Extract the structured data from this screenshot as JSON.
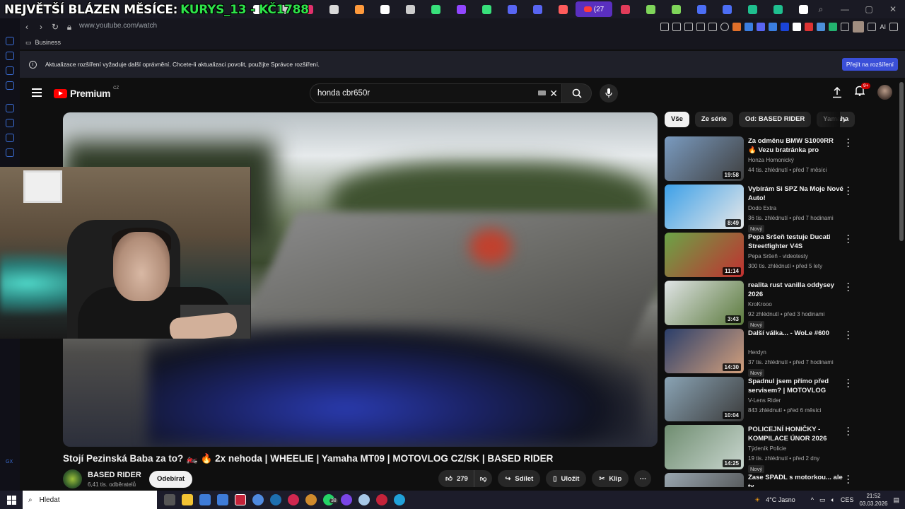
{
  "overlay": {
    "part1": "NEJVĚTŠÍ BLÁZEN MĚSÍCE:",
    "part2": "KURYS_13 - KČ1788"
  },
  "browser": {
    "active_tab_count": "(27",
    "url": "www.youtube.com/watch",
    "bookmark": "Business",
    "ai_label": "AI",
    "tab_colors": [
      "#ffffff",
      "#cfcfcf",
      "#e1306c",
      "#d9d9d9",
      "#ff9a3c",
      "#ffffff",
      "#cccccc",
      "#38e07b",
      "#9146ff",
      "#38e07b",
      "#5865f2",
      "#5865f2",
      "#ff5c5c",
      "#ff9a3c",
      "#e23c5a",
      "#7fd55a",
      "#7fd55a",
      "#4c6ef5",
      "#4c6ef5",
      "#1fbf8f",
      "#1fbf8f",
      "#ffffff"
    ]
  },
  "notification": {
    "text": "Aktualizace rozšíření vyžaduje další oprávnění. Chcete-li aktualizaci povolit, použijte Správce rozšíření.",
    "button": "Přejít na rozšíření"
  },
  "youtube": {
    "logo_text": "Premium",
    "logo_region": "CZ",
    "search_value": "honda cbr650r",
    "notif_count": "9+",
    "video_title": "Stojí Pezinská Baba za to? 🏍️ 🔥 2x nehoda | WHEELIE | Yamaha MT09 | MOTOVLOG CZ/SK | BASED RIDER",
    "channel": {
      "name": "BASED RIDER",
      "subs": "6,41 tis. odběratelů",
      "subscribe": "Odebírat"
    },
    "actions": {
      "likes": "279",
      "share": "Sdílet",
      "save": "Uložit",
      "clip": "Klip"
    },
    "chips": [
      "Vše",
      "Ze série",
      "Od: BASED RIDER",
      "Yamaha"
    ],
    "recommendations": [
      {
        "title": "Za odměnu BMW S1000RR 🔥 Vezu bratránka pro vysvědčení",
        "channel": "Honza Homonický",
        "meta": "44 tis. zhlédnutí • před 7 měsíci",
        "duration": "19:58",
        "badge": "",
        "colors": [
          "#7a9bc0",
          "#3f3f3f"
        ]
      },
      {
        "title": "Vybírám Si SPZ Na Moje Nové Auto!",
        "channel": "Dodo Extra",
        "meta": "36 tis. zhlédnutí • před 7 hodinami",
        "duration": "8:49",
        "badge": "Nový",
        "colors": [
          "#3ca0e8",
          "#e8e8e8"
        ]
      },
      {
        "title": "Pepa Sršeň testuje Ducati Streetfighter V4S",
        "channel": "Pepa Sršeň - videotesty",
        "meta": "300 tis. zhlédnutí • před 5 lety",
        "duration": "11:14",
        "badge": "",
        "colors": [
          "#6aa447",
          "#c23030"
        ]
      },
      {
        "title": "realita rust vanilla oddysey 2026",
        "channel": "KroKrooo",
        "meta": "92 zhlédnutí • před 3 hodinami",
        "duration": "3:43",
        "badge": "Nový",
        "colors": [
          "#e0e4e6",
          "#5b7a3c"
        ]
      },
      {
        "title": "Další válka... - WoLe #600",
        "channel": "Herdyn",
        "meta": "37 tis. zhlédnutí • před 7 hodinami",
        "duration": "14:30",
        "badge": "Nový",
        "colors": [
          "#2a3e6a",
          "#d4a07c"
        ]
      },
      {
        "title": "Spadnul jsem přímo před servisem? | MOTOVLOG CZ/S...",
        "channel": "V-Lens Rider",
        "meta": "843 zhlédnutí • před 6 měsíci",
        "duration": "10:04",
        "badge": "",
        "colors": [
          "#8aa4b5",
          "#3b3b3b"
        ]
      },
      {
        "title": "POLICEJNÍ HONIČKY - KOMPILACE ÚNOR 2026",
        "channel": "Týdeník Policie",
        "meta": "19 tis. zhlédnutí • před 2 dny",
        "duration": "14:25",
        "badge": "Nový",
        "colors": [
          "#6f8d70",
          "#c9d6cf"
        ]
      },
      {
        "title": "Zase SPADL s motorkou... ale ty",
        "channel": "",
        "meta": "",
        "duration": "",
        "badge": "",
        "colors": [
          "#9aa7b0",
          "#444"
        ]
      }
    ]
  },
  "taskbar": {
    "search": "Hledat",
    "weather": "4°C  Jasno",
    "lang": "CES",
    "time": "21:52",
    "date": "03.03.2026",
    "badge_whatsapp": "38",
    "icon_colors": [
      "#555",
      "#f2c233",
      "#3e7bd8",
      "#3e7bd8",
      "#c4233a",
      "#4f8ae0",
      "#1e6fb0",
      "#d02850",
      "#d08a2c",
      "#25d366",
      "#7a45e6",
      "#a7c7e7",
      "#c4233a",
      "#20a0d8"
    ]
  }
}
